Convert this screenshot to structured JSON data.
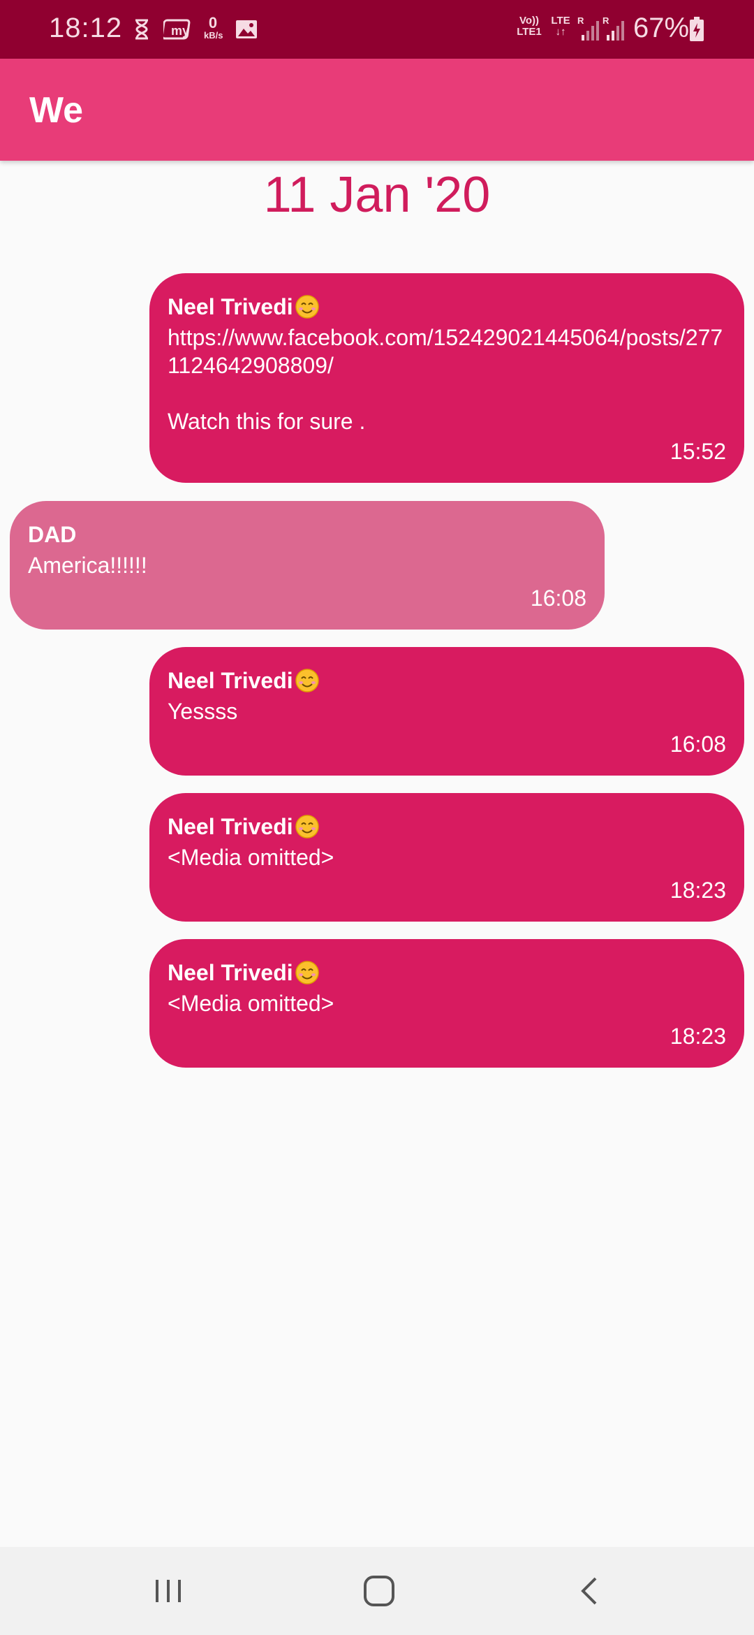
{
  "status_bar": {
    "time": "18:12",
    "data_speed_value": "0",
    "data_speed_unit": "kB/s",
    "network_volte": "Vo))",
    "network_lte1": "LTE1",
    "network_lte": "LTE",
    "roaming_1": "R",
    "roaming_2": "R",
    "battery": "67%",
    "icons": [
      "hourglass-icon",
      "myntra-icon",
      "image-icon",
      "signal-icon",
      "battery-charging-icon"
    ]
  },
  "app_bar": {
    "title": "We"
  },
  "chat": {
    "date": "11 Jan '20",
    "messages": [
      {
        "sender": "Neel Trivedi",
        "sender_emoji": "smiling-face-emoji",
        "text": "https://www.facebook.com/152429021445064/posts/2771124642908809/\n\nWatch this for sure .",
        "time": "15:52",
        "outgoing": true
      },
      {
        "sender": "DAD",
        "text": "America!!!!!!",
        "time": "16:08",
        "outgoing": false
      },
      {
        "sender": "Neel Trivedi",
        "sender_emoji": "smiling-face-emoji",
        "text": "Yessss",
        "time": "16:08",
        "outgoing": true
      },
      {
        "sender": "Neel Trivedi",
        "sender_emoji": "smiling-face-emoji",
        "text": "<Media omitted>",
        "time": "18:23",
        "outgoing": true
      },
      {
        "sender": "Neel Trivedi",
        "sender_emoji": "smiling-face-emoji",
        "text": "<Media omitted>",
        "time": "18:23",
        "outgoing": true
      }
    ]
  },
  "nav_bar": {
    "buttons": [
      "recent-apps-icon",
      "home-icon",
      "back-icon"
    ]
  },
  "colors": {
    "status_bar": "#900030",
    "app_bar": "#e83c78",
    "outgoing_bubble": "#d81b60",
    "incoming_bubble": "#dc6890",
    "date_text": "#d01c5c"
  }
}
